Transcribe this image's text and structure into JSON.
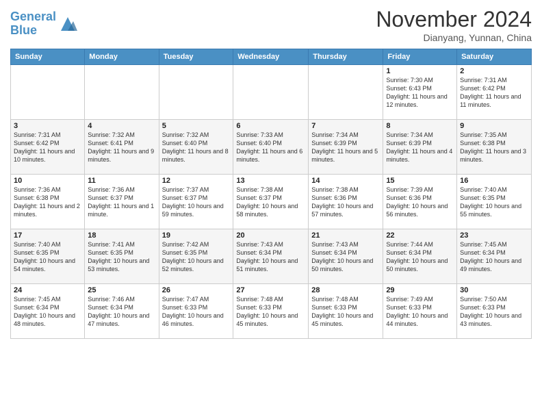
{
  "logo": {
    "line1": "General",
    "line2": "Blue"
  },
  "title": "November 2024",
  "subtitle": "Dianyang, Yunnan, China",
  "weekdays": [
    "Sunday",
    "Monday",
    "Tuesday",
    "Wednesday",
    "Thursday",
    "Friday",
    "Saturday"
  ],
  "weeks": [
    [
      {
        "day": "",
        "info": ""
      },
      {
        "day": "",
        "info": ""
      },
      {
        "day": "",
        "info": ""
      },
      {
        "day": "",
        "info": ""
      },
      {
        "day": "",
        "info": ""
      },
      {
        "day": "1",
        "info": "Sunrise: 7:30 AM\nSunset: 6:43 PM\nDaylight: 11 hours and 12 minutes."
      },
      {
        "day": "2",
        "info": "Sunrise: 7:31 AM\nSunset: 6:42 PM\nDaylight: 11 hours and 11 minutes."
      }
    ],
    [
      {
        "day": "3",
        "info": "Sunrise: 7:31 AM\nSunset: 6:42 PM\nDaylight: 11 hours and 10 minutes."
      },
      {
        "day": "4",
        "info": "Sunrise: 7:32 AM\nSunset: 6:41 PM\nDaylight: 11 hours and 9 minutes."
      },
      {
        "day": "5",
        "info": "Sunrise: 7:32 AM\nSunset: 6:40 PM\nDaylight: 11 hours and 8 minutes."
      },
      {
        "day": "6",
        "info": "Sunrise: 7:33 AM\nSunset: 6:40 PM\nDaylight: 11 hours and 6 minutes."
      },
      {
        "day": "7",
        "info": "Sunrise: 7:34 AM\nSunset: 6:39 PM\nDaylight: 11 hours and 5 minutes."
      },
      {
        "day": "8",
        "info": "Sunrise: 7:34 AM\nSunset: 6:39 PM\nDaylight: 11 hours and 4 minutes."
      },
      {
        "day": "9",
        "info": "Sunrise: 7:35 AM\nSunset: 6:38 PM\nDaylight: 11 hours and 3 minutes."
      }
    ],
    [
      {
        "day": "10",
        "info": "Sunrise: 7:36 AM\nSunset: 6:38 PM\nDaylight: 11 hours and 2 minutes."
      },
      {
        "day": "11",
        "info": "Sunrise: 7:36 AM\nSunset: 6:37 PM\nDaylight: 11 hours and 1 minute."
      },
      {
        "day": "12",
        "info": "Sunrise: 7:37 AM\nSunset: 6:37 PM\nDaylight: 10 hours and 59 minutes."
      },
      {
        "day": "13",
        "info": "Sunrise: 7:38 AM\nSunset: 6:37 PM\nDaylight: 10 hours and 58 minutes."
      },
      {
        "day": "14",
        "info": "Sunrise: 7:38 AM\nSunset: 6:36 PM\nDaylight: 10 hours and 57 minutes."
      },
      {
        "day": "15",
        "info": "Sunrise: 7:39 AM\nSunset: 6:36 PM\nDaylight: 10 hours and 56 minutes."
      },
      {
        "day": "16",
        "info": "Sunrise: 7:40 AM\nSunset: 6:35 PM\nDaylight: 10 hours and 55 minutes."
      }
    ],
    [
      {
        "day": "17",
        "info": "Sunrise: 7:40 AM\nSunset: 6:35 PM\nDaylight: 10 hours and 54 minutes."
      },
      {
        "day": "18",
        "info": "Sunrise: 7:41 AM\nSunset: 6:35 PM\nDaylight: 10 hours and 53 minutes."
      },
      {
        "day": "19",
        "info": "Sunrise: 7:42 AM\nSunset: 6:35 PM\nDaylight: 10 hours and 52 minutes."
      },
      {
        "day": "20",
        "info": "Sunrise: 7:43 AM\nSunset: 6:34 PM\nDaylight: 10 hours and 51 minutes."
      },
      {
        "day": "21",
        "info": "Sunrise: 7:43 AM\nSunset: 6:34 PM\nDaylight: 10 hours and 50 minutes."
      },
      {
        "day": "22",
        "info": "Sunrise: 7:44 AM\nSunset: 6:34 PM\nDaylight: 10 hours and 50 minutes."
      },
      {
        "day": "23",
        "info": "Sunrise: 7:45 AM\nSunset: 6:34 PM\nDaylight: 10 hours and 49 minutes."
      }
    ],
    [
      {
        "day": "24",
        "info": "Sunrise: 7:45 AM\nSunset: 6:34 PM\nDaylight: 10 hours and 48 minutes."
      },
      {
        "day": "25",
        "info": "Sunrise: 7:46 AM\nSunset: 6:34 PM\nDaylight: 10 hours and 47 minutes."
      },
      {
        "day": "26",
        "info": "Sunrise: 7:47 AM\nSunset: 6:33 PM\nDaylight: 10 hours and 46 minutes."
      },
      {
        "day": "27",
        "info": "Sunrise: 7:48 AM\nSunset: 6:33 PM\nDaylight: 10 hours and 45 minutes."
      },
      {
        "day": "28",
        "info": "Sunrise: 7:48 AM\nSunset: 6:33 PM\nDaylight: 10 hours and 45 minutes."
      },
      {
        "day": "29",
        "info": "Sunrise: 7:49 AM\nSunset: 6:33 PM\nDaylight: 10 hours and 44 minutes."
      },
      {
        "day": "30",
        "info": "Sunrise: 7:50 AM\nSunset: 6:33 PM\nDaylight: 10 hours and 43 minutes."
      }
    ]
  ]
}
